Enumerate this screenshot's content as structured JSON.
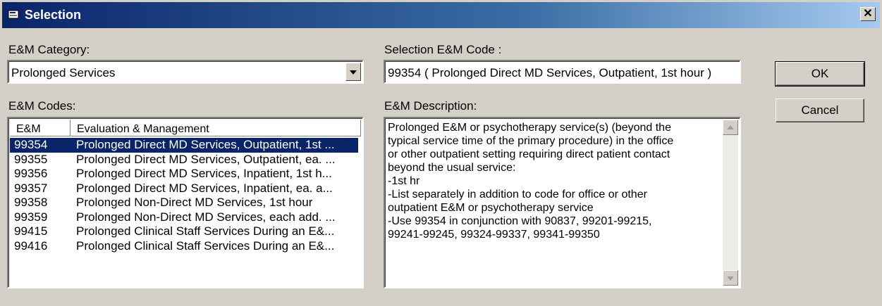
{
  "window": {
    "title": "Selection",
    "close_glyph": "✕"
  },
  "category": {
    "label": "E&M Category:",
    "value": "Prolonged Services"
  },
  "selection_code": {
    "label": "Selection E&M Code :",
    "value": "99354 (  Prolonged Direct MD Services, Outpatient, 1st hour )"
  },
  "codes": {
    "label": "E&M Codes:",
    "columns": [
      "E&M",
      "Evaluation & Management"
    ],
    "rows": [
      {
        "code": "99354",
        "desc": "Prolonged Direct MD Services, Outpatient, 1st ..."
      },
      {
        "code": "99355",
        "desc": "Prolonged Direct MD Services, Outpatient, ea. ..."
      },
      {
        "code": "99356",
        "desc": "Prolonged Direct MD Services, Inpatient, 1st h..."
      },
      {
        "code": "99357",
        "desc": "Prolonged Direct MD Services, Inpatient, ea. a..."
      },
      {
        "code": "99358",
        "desc": "Prolonged Non-Direct MD Services, 1st hour"
      },
      {
        "code": "99359",
        "desc": "Prolonged Non-Direct MD Services, each add. ..."
      },
      {
        "code": "99415",
        "desc": "Prolonged Clinical Staff Services During an E&..."
      },
      {
        "code": "99416",
        "desc": "Prolonged Clinical Staff Services During an E&..."
      }
    ],
    "selected_index": 0
  },
  "description": {
    "label": "E&M Description:",
    "lines": [
      "Prolonged E&M or psychotherapy service(s) (beyond the",
      "typical service time of the primary procedure) in the office",
      "or other outpatient setting requiring direct patient contact",
      "beyond the usual service:",
      "-1st hr",
      "-List separately in addition to code for office or other",
      "outpatient E&M or psychotherapy service",
      "-Use 99354 in conjunction with 90837, 99201-99215,",
      "99241-99245, 99324-99337, 99341-99350"
    ]
  },
  "buttons": {
    "ok": "OK",
    "cancel": "Cancel"
  }
}
